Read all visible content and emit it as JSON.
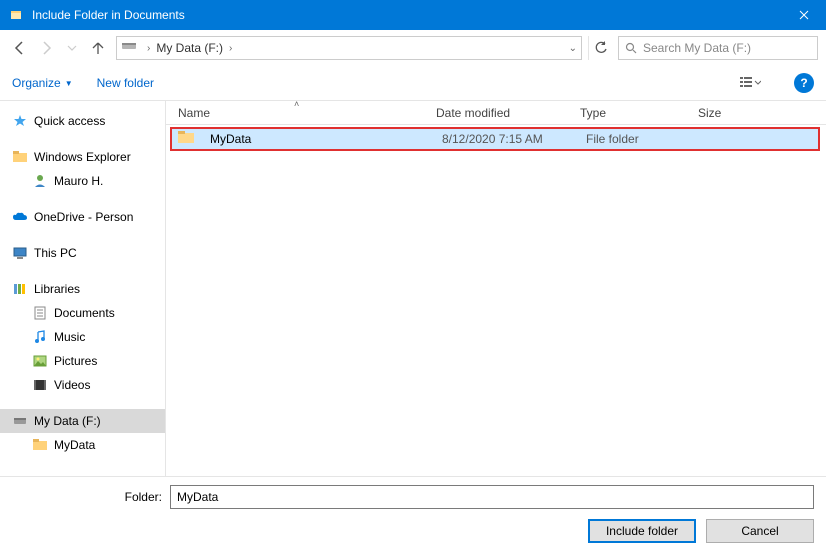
{
  "window": {
    "title": "Include Folder in Documents"
  },
  "nav": {
    "address": {
      "drive": "My Data (F:)"
    }
  },
  "search": {
    "placeholder": "Search My Data (F:)"
  },
  "toolbar": {
    "organize": "Organize",
    "newfolder": "New folder"
  },
  "columns": {
    "name": "Name",
    "modified": "Date modified",
    "type": "Type",
    "size": "Size"
  },
  "sidebar": {
    "quick_access": "Quick access",
    "windows_explorer": "Windows Explorer",
    "user": "Mauro H.",
    "onedrive": "OneDrive - Person",
    "this_pc": "This PC",
    "libraries": "Libraries",
    "documents": "Documents",
    "music": "Music",
    "pictures": "Pictures",
    "videos": "Videos",
    "mydata_drive": "My Data (F:)",
    "mydata_folder": "MyData"
  },
  "files": [
    {
      "name": "MyData",
      "modified": "8/12/2020 7:15 AM",
      "type": "File folder",
      "size": ""
    }
  ],
  "bottom": {
    "label": "Folder:",
    "value": "MyData",
    "include": "Include folder",
    "cancel": "Cancel"
  }
}
